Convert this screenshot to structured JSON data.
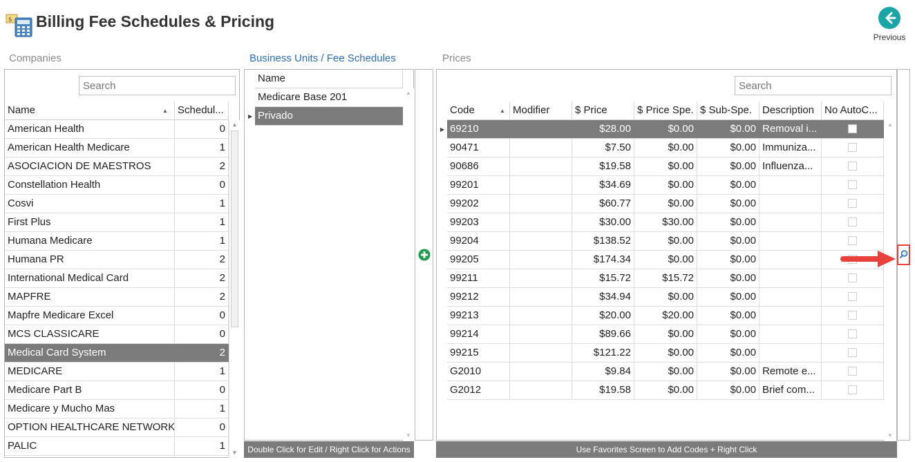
{
  "header": {
    "title": "Billing Fee Schedules & Pricing",
    "previous_label": "Previous"
  },
  "sections": {
    "companies": "Companies",
    "business_units": "Business Units / Fee Schedules",
    "prices": "Prices"
  },
  "companies": {
    "search_placeholder": "Search",
    "columns": {
      "name": "Name",
      "schedules": "Schedul..."
    },
    "rows": [
      {
        "name": "American Health",
        "count": "0"
      },
      {
        "name": "American Health Medicare",
        "count": "1"
      },
      {
        "name": "ASOCIACION DE MAESTROS",
        "count": "2"
      },
      {
        "name": "Constellation Health",
        "count": "0"
      },
      {
        "name": "Cosvi",
        "count": "1"
      },
      {
        "name": "First Plus",
        "count": "1"
      },
      {
        "name": "Humana Medicare",
        "count": "1"
      },
      {
        "name": "Humana PR",
        "count": "2"
      },
      {
        "name": "International Medical Card",
        "count": "2"
      },
      {
        "name": "MAPFRE",
        "count": "2"
      },
      {
        "name": "Mapfre Medicare Excel",
        "count": "0"
      },
      {
        "name": "MCS CLASSICARE",
        "count": "0"
      },
      {
        "name": "Medical Card System",
        "count": "2"
      },
      {
        "name": "MEDICARE",
        "count": "1"
      },
      {
        "name": "Medicare Part B",
        "count": "0"
      },
      {
        "name": "Medicare y Mucho Mas",
        "count": "1"
      },
      {
        "name": "OPTION HEALTHCARE NETWORK",
        "count": "0"
      },
      {
        "name": "PALIC",
        "count": "1"
      }
    ],
    "selected_index": 12
  },
  "business_units": {
    "column_name": "Name",
    "rows": [
      {
        "name": "Medicare Base 201"
      },
      {
        "name": "Privado"
      }
    ],
    "selected_index": 1,
    "footer": "Double Click for Edit / Right Click for Actions"
  },
  "prices": {
    "search_placeholder": "Search",
    "columns": {
      "code": "Code",
      "modifier": "Modifier",
      "price": "$ Price",
      "price_spe": "$ Price Spe.",
      "sub_spe": "$ Sub-Spe.",
      "description": "Description",
      "no_autoc": "No AutoC..."
    },
    "rows": [
      {
        "code": "69210",
        "modifier": "",
        "price": "$28.00",
        "price_spe": "$0.00",
        "sub_spe": "$0.00",
        "description": "Removal i..."
      },
      {
        "code": "90471",
        "modifier": "",
        "price": "$7.50",
        "price_spe": "$0.00",
        "sub_spe": "$0.00",
        "description": "Immuniza..."
      },
      {
        "code": "90686",
        "modifier": "",
        "price": "$19.58",
        "price_spe": "$0.00",
        "sub_spe": "$0.00",
        "description": "Influenza..."
      },
      {
        "code": "99201",
        "modifier": "",
        "price": "$34.69",
        "price_spe": "$0.00",
        "sub_spe": "$0.00",
        "description": ""
      },
      {
        "code": "99202",
        "modifier": "",
        "price": "$60.77",
        "price_spe": "$0.00",
        "sub_spe": "$0.00",
        "description": ""
      },
      {
        "code": "99203",
        "modifier": "",
        "price": "$30.00",
        "price_spe": "$30.00",
        "sub_spe": "$0.00",
        "description": ""
      },
      {
        "code": "99204",
        "modifier": "",
        "price": "$138.52",
        "price_spe": "$0.00",
        "sub_spe": "$0.00",
        "description": ""
      },
      {
        "code": "99205",
        "modifier": "",
        "price": "$174.34",
        "price_spe": "$0.00",
        "sub_spe": "$0.00",
        "description": ""
      },
      {
        "code": "99211",
        "modifier": "",
        "price": "$15.72",
        "price_spe": "$15.72",
        "sub_spe": "$0.00",
        "description": ""
      },
      {
        "code": "99212",
        "modifier": "",
        "price": "$34.94",
        "price_spe": "$0.00",
        "sub_spe": "$0.00",
        "description": ""
      },
      {
        "code": "99213",
        "modifier": "",
        "price": "$20.00",
        "price_spe": "$20.00",
        "sub_spe": "$0.00",
        "description": ""
      },
      {
        "code": "99214",
        "modifier": "",
        "price": "$89.66",
        "price_spe": "$0.00",
        "sub_spe": "$0.00",
        "description": ""
      },
      {
        "code": "99215",
        "modifier": "",
        "price": "$121.22",
        "price_spe": "$0.00",
        "sub_spe": "$0.00",
        "description": ""
      },
      {
        "code": "G2010",
        "modifier": "",
        "price": "$9.84",
        "price_spe": "$0.00",
        "sub_spe": "$0.00",
        "description": "Remote e..."
      },
      {
        "code": "G2012",
        "modifier": "",
        "price": "$19.58",
        "price_spe": "$0.00",
        "sub_spe": "$0.00",
        "description": "Brief com..."
      }
    ],
    "selected_index": 0,
    "footer": "Use Favorites Screen to Add Codes + Right Click"
  },
  "icons": {
    "add": "plus-circle-icon",
    "search": "magnifier-icon",
    "previous": "arrow-left-icon",
    "app": "calculator-icon"
  },
  "colors": {
    "selected_row": "#7b7b7b",
    "accent_teal": "#1aa5a6",
    "add_green": "#1e9e4a",
    "link_blue": "#2a6ebb",
    "highlight_red": "#e8403a"
  }
}
